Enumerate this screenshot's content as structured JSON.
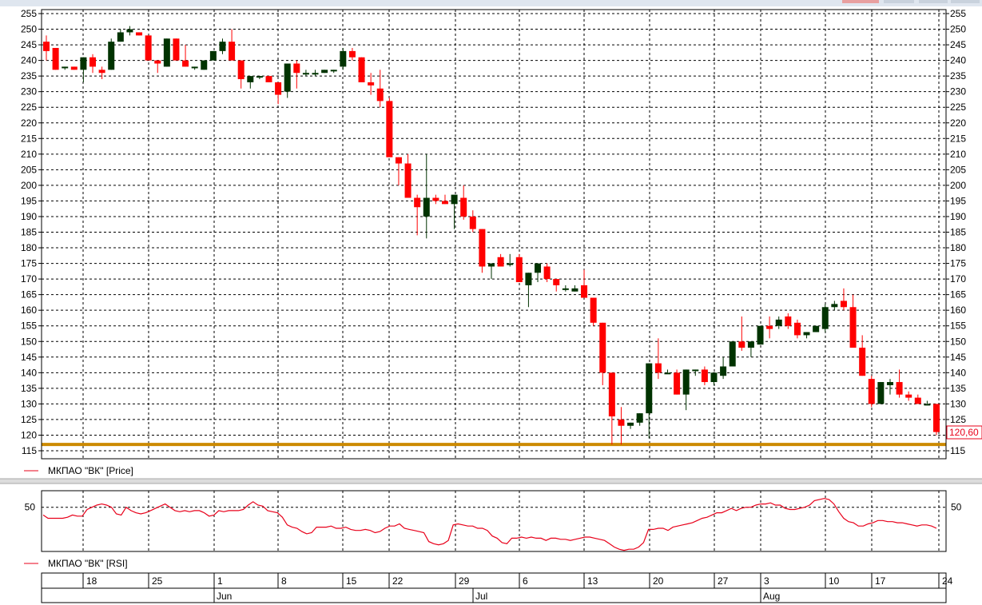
{
  "chart_data": [
    {
      "type": "candlestick",
      "ylim": [
        115,
        255
      ],
      "ytick_step": 5,
      "grid": true,
      "last_price_label": "120,60",
      "support_level": 117,
      "legend": {
        "label": "МКПАО \"ВК\" [Price]"
      },
      "candles": [
        {
          "o": 246,
          "h": 248,
          "l": 240,
          "c": 243
        },
        {
          "o": 244,
          "h": 244,
          "l": 237,
          "c": 237
        },
        {
          "o": 238,
          "h": 238,
          "l": 237,
          "c": 238
        },
        {
          "o": 238,
          "h": 238,
          "l": 237,
          "c": 237
        },
        {
          "o": 237,
          "h": 241,
          "l": 233,
          "c": 241
        },
        {
          "o": 241,
          "h": 242,
          "l": 236,
          "c": 238
        },
        {
          "o": 237,
          "h": 238,
          "l": 234,
          "c": 236
        },
        {
          "o": 237,
          "h": 247,
          "l": 237,
          "c": 246
        },
        {
          "o": 246,
          "h": 250,
          "l": 246,
          "c": 249
        },
        {
          "o": 249,
          "h": 251,
          "l": 248,
          "c": 250
        },
        {
          "o": 249,
          "h": 249,
          "l": 248,
          "c": 248
        },
        {
          "o": 248,
          "h": 248,
          "l": 240,
          "c": 240
        },
        {
          "o": 240,
          "h": 240,
          "l": 236,
          "c": 239
        },
        {
          "o": 238,
          "h": 247,
          "l": 238,
          "c": 247
        },
        {
          "o": 247,
          "h": 247,
          "l": 240,
          "c": 240
        },
        {
          "o": 240,
          "h": 245,
          "l": 238,
          "c": 238
        },
        {
          "o": 238,
          "h": 238,
          "l": 237,
          "c": 238
        },
        {
          "o": 237,
          "h": 240,
          "l": 237,
          "c": 240
        },
        {
          "o": 240,
          "h": 243,
          "l": 240,
          "c": 243
        },
        {
          "o": 243,
          "h": 247,
          "l": 242,
          "c": 246
        },
        {
          "o": 246,
          "h": 250,
          "l": 240,
          "c": 240
        },
        {
          "o": 240,
          "h": 240,
          "l": 231,
          "c": 234
        },
        {
          "o": 233,
          "h": 235,
          "l": 231,
          "c": 235
        },
        {
          "o": 235,
          "h": 235,
          "l": 234,
          "c": 235
        },
        {
          "o": 235,
          "h": 235,
          "l": 233,
          "c": 233
        },
        {
          "o": 233,
          "h": 233,
          "l": 226,
          "c": 229
        },
        {
          "o": 230,
          "h": 239,
          "l": 228,
          "c": 239
        },
        {
          "o": 239,
          "h": 240,
          "l": 231,
          "c": 236
        },
        {
          "o": 236,
          "h": 237,
          "l": 235,
          "c": 236
        },
        {
          "o": 236,
          "h": 237,
          "l": 235,
          "c": 236
        },
        {
          "o": 236,
          "h": 237,
          "l": 236,
          "c": 237
        },
        {
          "o": 237,
          "h": 237,
          "l": 236,
          "c": 237
        },
        {
          "o": 238,
          "h": 244,
          "l": 237,
          "c": 243
        },
        {
          "o": 243,
          "h": 244,
          "l": 240,
          "c": 241
        },
        {
          "o": 241,
          "h": 241,
          "l": 233,
          "c": 233
        },
        {
          "o": 233,
          "h": 236,
          "l": 229,
          "c": 232
        },
        {
          "o": 231,
          "h": 237,
          "l": 225,
          "c": 227
        },
        {
          "o": 227,
          "h": 228,
          "l": 212,
          "c": 209
        },
        {
          "o": 209,
          "h": 209,
          "l": 200,
          "c": 207
        },
        {
          "o": 207,
          "h": 210,
          "l": 200,
          "c": 196
        },
        {
          "o": 196,
          "h": 197,
          "l": 184,
          "c": 193
        },
        {
          "o": 190,
          "h": 210,
          "l": 183,
          "c": 196
        },
        {
          "o": 196,
          "h": 197,
          "l": 194,
          "c": 195
        },
        {
          "o": 195,
          "h": 197,
          "l": 194,
          "c": 194
        },
        {
          "o": 194,
          "h": 196,
          "l": 186,
          "c": 197
        },
        {
          "o": 196,
          "h": 200,
          "l": 189,
          "c": 190
        },
        {
          "o": 190,
          "h": 192,
          "l": 185,
          "c": 186
        },
        {
          "o": 186,
          "h": 186,
          "l": 172,
          "c": 174
        },
        {
          "o": 174,
          "h": 175,
          "l": 170,
          "c": 175
        },
        {
          "o": 177,
          "h": 178,
          "l": 174,
          "c": 174
        },
        {
          "o": 175,
          "h": 178,
          "l": 174,
          "c": 175
        },
        {
          "o": 177,
          "h": 178,
          "l": 169,
          "c": 169
        },
        {
          "o": 168,
          "h": 172,
          "l": 161,
          "c": 172
        },
        {
          "o": 172,
          "h": 175,
          "l": 169,
          "c": 175
        },
        {
          "o": 174,
          "h": 175,
          "l": 169,
          "c": 170
        },
        {
          "o": 170,
          "h": 170,
          "l": 166,
          "c": 168
        },
        {
          "o": 167,
          "h": 168,
          "l": 166,
          "c": 167
        },
        {
          "o": 166,
          "h": 168,
          "l": 166,
          "c": 167
        },
        {
          "o": 168,
          "h": 173,
          "l": 164,
          "c": 164
        },
        {
          "o": 164,
          "h": 164,
          "l": 155,
          "c": 156
        },
        {
          "o": 156,
          "h": 156,
          "l": 136,
          "c": 140
        },
        {
          "o": 140,
          "h": 140,
          "l": 117,
          "c": 126
        },
        {
          "o": 125,
          "h": 129,
          "l": 117,
          "c": 123
        },
        {
          "o": 123,
          "h": 124,
          "l": 122,
          "c": 124
        },
        {
          "o": 124,
          "h": 127,
          "l": 123,
          "c": 127
        },
        {
          "o": 127,
          "h": 143,
          "l": 119,
          "c": 143
        },
        {
          "o": 143,
          "h": 151,
          "l": 138,
          "c": 140
        },
        {
          "o": 140,
          "h": 141,
          "l": 140,
          "c": 140
        },
        {
          "o": 140,
          "h": 141,
          "l": 133,
          "c": 133
        },
        {
          "o": 133,
          "h": 141,
          "l": 128,
          "c": 141
        },
        {
          "o": 141,
          "h": 141,
          "l": 139,
          "c": 141
        },
        {
          "o": 141,
          "h": 142,
          "l": 136,
          "c": 137
        },
        {
          "o": 137,
          "h": 140,
          "l": 136,
          "c": 140
        },
        {
          "o": 139,
          "h": 145,
          "l": 138,
          "c": 142
        },
        {
          "o": 142,
          "h": 150,
          "l": 142,
          "c": 150
        },
        {
          "o": 150,
          "h": 158,
          "l": 147,
          "c": 148
        },
        {
          "o": 148,
          "h": 150,
          "l": 145,
          "c": 150
        },
        {
          "o": 149,
          "h": 155,
          "l": 149,
          "c": 155
        },
        {
          "o": 155,
          "h": 158,
          "l": 151,
          "c": 154
        },
        {
          "o": 155,
          "h": 158,
          "l": 154,
          "c": 157
        },
        {
          "o": 158,
          "h": 159,
          "l": 154,
          "c": 155
        },
        {
          "o": 156,
          "h": 157,
          "l": 151,
          "c": 152
        },
        {
          "o": 152,
          "h": 153,
          "l": 151,
          "c": 153
        },
        {
          "o": 153,
          "h": 155,
          "l": 153,
          "c": 155
        },
        {
          "o": 154,
          "h": 162,
          "l": 153,
          "c": 161
        },
        {
          "o": 161,
          "h": 163,
          "l": 160,
          "c": 162
        },
        {
          "o": 163,
          "h": 167,
          "l": 160,
          "c": 161
        },
        {
          "o": 161,
          "h": 165,
          "l": 148,
          "c": 148
        },
        {
          "o": 148,
          "h": 152,
          "l": 139,
          "c": 139
        },
        {
          "o": 138,
          "h": 139,
          "l": 129,
          "c": 130
        },
        {
          "o": 130,
          "h": 137,
          "l": 130,
          "c": 137
        },
        {
          "o": 136,
          "h": 138,
          "l": 133,
          "c": 137
        },
        {
          "o": 137,
          "h": 141,
          "l": 132,
          "c": 133
        },
        {
          "o": 133,
          "h": 134,
          "l": 131,
          "c": 132
        },
        {
          "o": 132,
          "h": 133,
          "l": 130,
          "c": 130
        },
        {
          "o": 130,
          "h": 131,
          "l": 130,
          "c": 130
        },
        {
          "o": 130,
          "h": 130,
          "l": 120,
          "c": 121
        }
      ]
    },
    {
      "type": "line",
      "ytick_value": 50,
      "ylim": [
        10,
        65
      ],
      "legend": {
        "label": "МКПАО \"ВК\" [RSI]"
      },
      "values": [
        43,
        40,
        40,
        40,
        40,
        41,
        43,
        42,
        42,
        48,
        50,
        52,
        53,
        52,
        50,
        44,
        43,
        50,
        47,
        45,
        44,
        45,
        47,
        49,
        51,
        53,
        50,
        47,
        46,
        47,
        46,
        47,
        47,
        45,
        42,
        43,
        47,
        46,
        47,
        47,
        47,
        48,
        52,
        55,
        52,
        51,
        47,
        46,
        45,
        41,
        34,
        32,
        31,
        28,
        26,
        27,
        32,
        32,
        32,
        33,
        31,
        31,
        32,
        30,
        29,
        29,
        30,
        29,
        27,
        28,
        31,
        33,
        33,
        35,
        31,
        30,
        29,
        28,
        27,
        19,
        17,
        16,
        17,
        20,
        34,
        35,
        34,
        33,
        33,
        31,
        31,
        29,
        24,
        22,
        18,
        17,
        22,
        22,
        23,
        22,
        23,
        22,
        22,
        20,
        22,
        22,
        21,
        21,
        20,
        21,
        22,
        23,
        23,
        22,
        21,
        20,
        17,
        14,
        12,
        11,
        12,
        12,
        14,
        18,
        30,
        30,
        31,
        31,
        29,
        32,
        33,
        34,
        35,
        36,
        38,
        40,
        41,
        43,
        45,
        45,
        47,
        49,
        47,
        49,
        50,
        50,
        52,
        53,
        53,
        54,
        52,
        52,
        49,
        48,
        48,
        49,
        50,
        52,
        56,
        57,
        58,
        57,
        53,
        46,
        40,
        37,
        36,
        33,
        33,
        35,
        36,
        38,
        38,
        37,
        37,
        36,
        36,
        35,
        34,
        33,
        34,
        34,
        33,
        31
      ]
    },
    {
      "type": "date_axis",
      "days": [
        "18",
        "25",
        "1",
        "8",
        "15",
        "22",
        "29",
        "6",
        "13",
        "20",
        "27",
        "3",
        "10",
        "17",
        "24"
      ],
      "months": [
        "Jun",
        "Jul",
        "Aug"
      ]
    }
  ]
}
